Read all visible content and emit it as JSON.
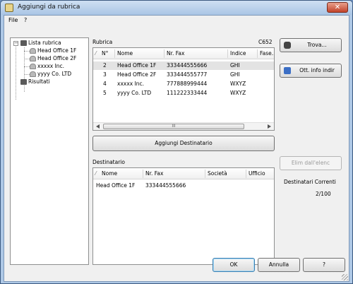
{
  "window": {
    "title": "Aggiungi da rubrica"
  },
  "menu": [
    "File",
    "?"
  ],
  "tree": {
    "root_label": "Lista rubrica",
    "children": [
      "Head Office 1F",
      "Head Office 2F",
      "xxxxx Inc.",
      "yyyy Co. LTD"
    ],
    "results_label": "Risultati"
  },
  "rubrica": {
    "label": "Rubrica",
    "model": "C652",
    "columns": [
      "N°",
      "Nome",
      "Nr. Fax",
      "Indice",
      "Fase"
    ],
    "rows": [
      {
        "n": "2",
        "name": "Head Office 1F",
        "fax": "333444555666",
        "index": "GHI"
      },
      {
        "n": "3",
        "name": "Head Office 2F",
        "fax": "333444555777",
        "index": "GHI"
      },
      {
        "n": "4",
        "name": "xxxxx Inc.",
        "fax": "777888999444",
        "index": "WXYZ"
      },
      {
        "n": "5",
        "name": "yyyy Co. LTD",
        "fax": "111222333444",
        "index": "WXYZ"
      }
    ],
    "selected_row": 0
  },
  "buttons": {
    "find": "Trova...",
    "get_info": "Ott. info indir",
    "add_recipient": "Aggiungi Destinatario",
    "remove": "Elim dall'elenc",
    "ok": "OK",
    "cancel": "Annulla",
    "help": "?"
  },
  "destinatario": {
    "label": "Destinatario",
    "columns": [
      "Nome",
      "Nr. Fax",
      "Società",
      "Ufficio"
    ],
    "rows": [
      {
        "name": "Head Office 1F",
        "fax": "333444555666"
      }
    ]
  },
  "current_recipients": {
    "label": "Destinatari Correnti",
    "count": "2/100"
  },
  "scrollbar_thumb_glyph": "III"
}
